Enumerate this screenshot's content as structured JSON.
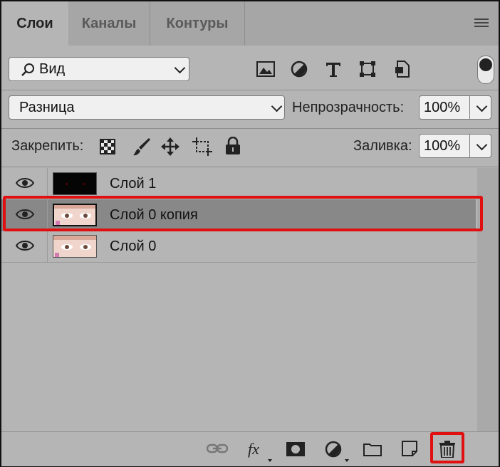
{
  "tabs": [
    "Слои",
    "Каналы",
    "Контуры"
  ],
  "filter": {
    "label": "Вид"
  },
  "blend": {
    "mode": "Разница",
    "opacity_label": "Непрозрачность:",
    "opacity_value": "100%"
  },
  "lock": {
    "label": "Закрепить:",
    "fill_label": "Заливка:",
    "fill_value": "100%"
  },
  "layers": [
    {
      "name": "Слой 1",
      "selected": false
    },
    {
      "name": "Слой 0 копия",
      "selected": true
    },
    {
      "name": "Слой 0",
      "selected": false
    }
  ],
  "colors": {
    "panel": "#b5b5b5",
    "selected_row": "#888888",
    "highlight": "#e01010"
  },
  "icons": {
    "toolbar": [
      "image-icon",
      "adjustment-icon",
      "type-icon",
      "shape-icon",
      "smart-object-icon",
      "filter-toggle-icon"
    ],
    "lock": [
      "lock-pixels-icon",
      "lock-paint-icon",
      "lock-move-icon",
      "lock-artboard-icon",
      "lock-all-icon"
    ],
    "bottom": [
      "link-icon",
      "fx-icon",
      "mask-icon",
      "adjustment-layer-icon",
      "folder-icon",
      "new-layer-icon",
      "trash-icon"
    ]
  }
}
